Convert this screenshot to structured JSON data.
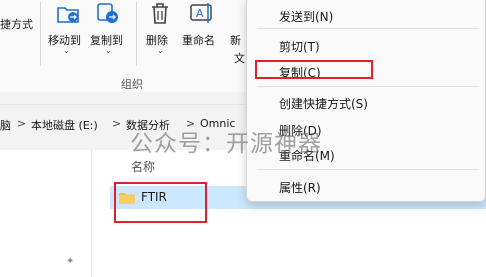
{
  "ribbon": {
    "left_partial_label": "捷方式",
    "move_to": "移动到",
    "copy_to": "复制到",
    "delete": "删除",
    "rename": "重命名",
    "partial_new_1": "新",
    "partial_new_2": "文",
    "group_label": "组织"
  },
  "address": {
    "partial_first": "脑",
    "drive": "本地磁盘 (E:)",
    "folder1": "数据分析",
    "folder2": "Omnic",
    "sep": ">"
  },
  "files": {
    "column_name": "名称",
    "rows": [
      {
        "name": "FTIR"
      }
    ]
  },
  "context_menu": {
    "send_to": "发送到(N)",
    "cut": "剪切(T)",
    "copy": "复制(C)",
    "create_shortcut": "创建快捷方式(S)",
    "delete": "删除(D)",
    "rename": "重命名(M)",
    "properties": "属性(R)"
  },
  "watermark": "公众号：开源神器",
  "colors": {
    "accent_blue": "#1f6fd1",
    "selection": "#cce8ff",
    "highlight_red": "#e0202a",
    "folder_yellow": "#f2c14e"
  }
}
